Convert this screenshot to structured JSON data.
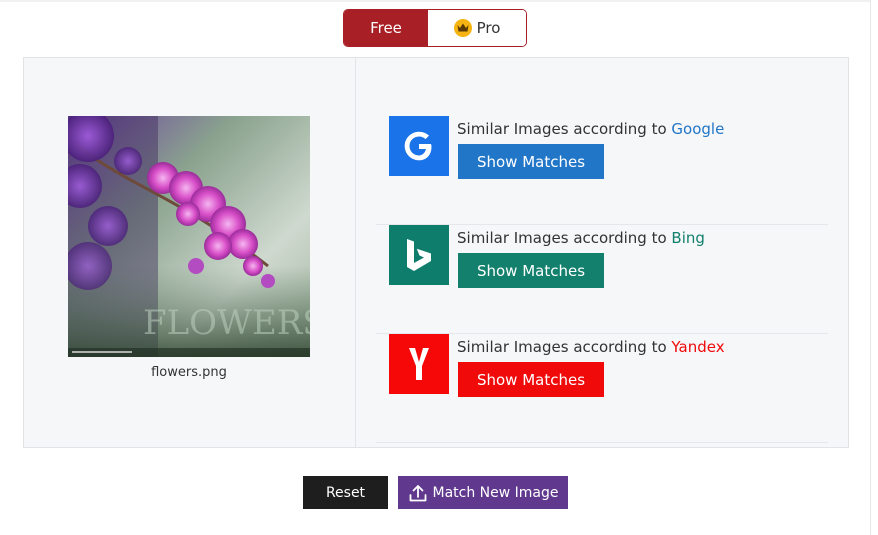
{
  "toggle": {
    "free_label": "Free",
    "pro_label": "Pro",
    "selected": "Free",
    "free_color": "#a81f25"
  },
  "preview": {
    "filename": "flowers.png",
    "watermark_text": "FLOWERS"
  },
  "engines": [
    {
      "prefix": "Similar Images according to ",
      "name": "Google",
      "button_label": "Show Matches",
      "color": "#2176c8",
      "logo_color": "#1a73e8",
      "icon": "google-icon"
    },
    {
      "prefix": "Similar Images according to ",
      "name": "Bing",
      "button_label": "Show Matches",
      "color": "#12806d",
      "logo_color": "#0f7d6c",
      "icon": "bing-icon"
    },
    {
      "prefix": "Similar Images according to ",
      "name": "Yandex",
      "button_label": "Show Matches",
      "color": "#f00a0a",
      "logo_color": "#f60808",
      "icon": "yandex-icon"
    }
  ],
  "actions": {
    "reset_label": "Reset",
    "match_label": "Match New Image"
  }
}
